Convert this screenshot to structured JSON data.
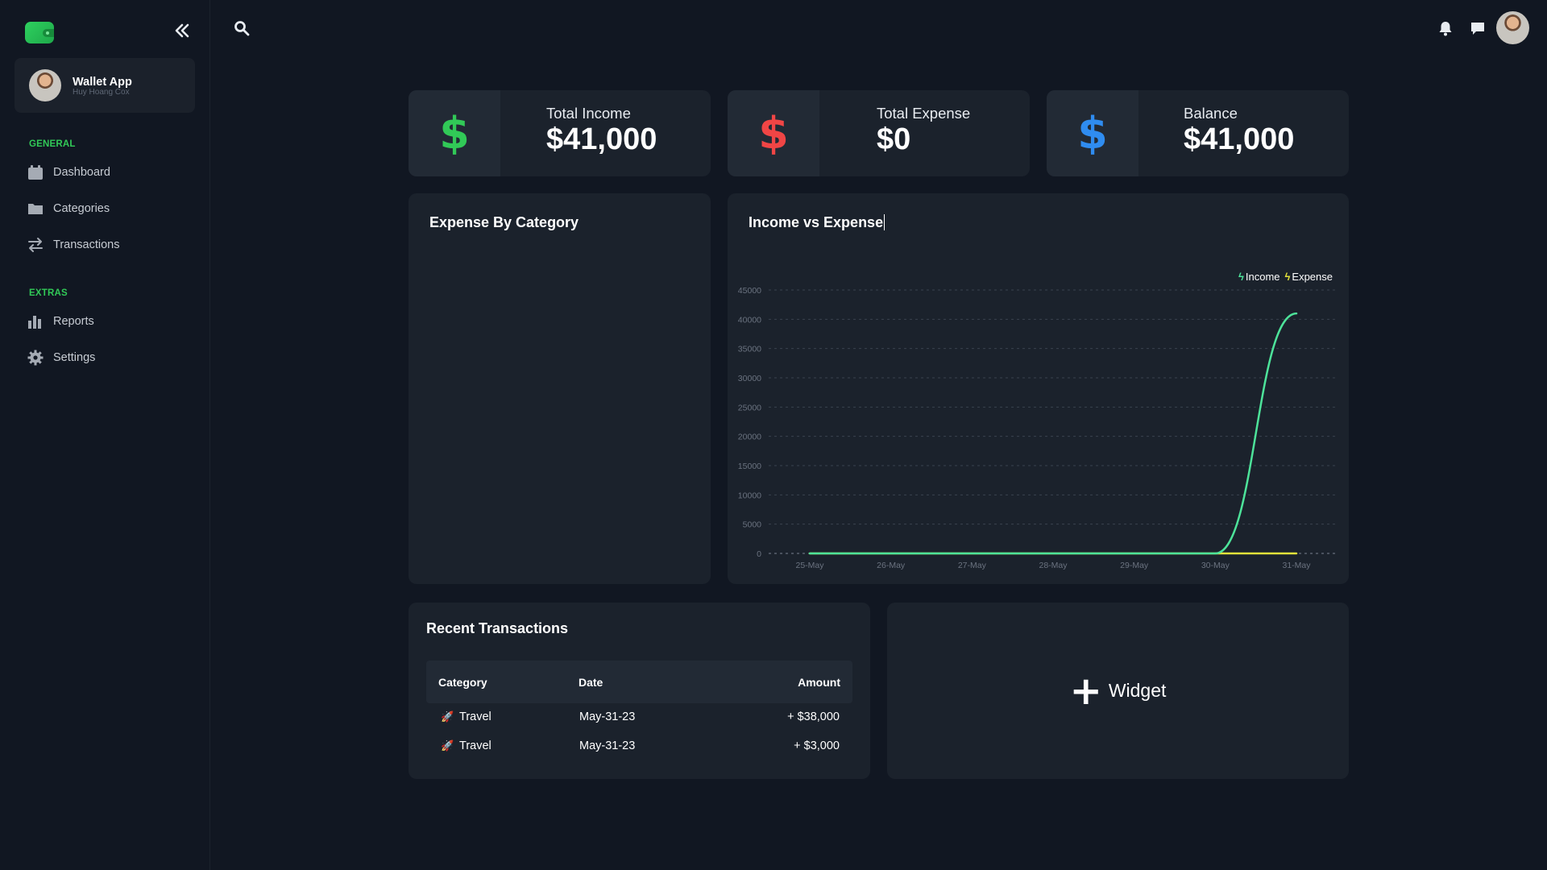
{
  "sidebar": {
    "profile": {
      "name": "Wallet App",
      "subtitle": "Huy Hoang Cox"
    },
    "sections": [
      {
        "title": "GENERAL",
        "items": [
          {
            "label": "Dashboard",
            "icon": "calendar-icon"
          },
          {
            "label": "Categories",
            "icon": "folder-icon"
          },
          {
            "label": "Transactions",
            "icon": "transfer-arrows-icon"
          }
        ]
      },
      {
        "title": "EXTRAS",
        "items": [
          {
            "label": "Reports",
            "icon": "bar-chart-icon"
          },
          {
            "label": "Settings",
            "icon": "gear-icon"
          }
        ]
      }
    ]
  },
  "stats": [
    {
      "label": "Total Income",
      "value": "$41,000",
      "symbol": "$",
      "color": "#31c957"
    },
    {
      "label": "Total Expense",
      "value": "$0",
      "symbol": "$",
      "color": "#f04545"
    },
    {
      "label": "Balance",
      "value": "$41,000",
      "symbol": "$",
      "color": "#2f8cf0"
    }
  ],
  "panels": {
    "expense_by_category": "Expense By Category",
    "income_vs_expense": "Income vs Expense",
    "recent_transactions": "Recent Transactions",
    "widget": "Widget"
  },
  "chart_data": {
    "type": "line",
    "title": "Income vs Expense",
    "categories": [
      "25-May",
      "26-May",
      "27-May",
      "28-May",
      "29-May",
      "30-May",
      "31-May"
    ],
    "yticks": [
      0,
      5000,
      10000,
      15000,
      20000,
      25000,
      30000,
      35000,
      40000,
      45000
    ],
    "ylim": [
      0,
      45000
    ],
    "series": [
      {
        "name": "Income",
        "color": "#4de39a",
        "values": [
          0,
          0,
          0,
          0,
          0,
          0,
          41000
        ]
      },
      {
        "name": "Expense",
        "color": "#e2e23a",
        "values": [
          0,
          0,
          0,
          0,
          0,
          0,
          0
        ]
      }
    ],
    "legend": "top-right",
    "grid": true
  },
  "table": {
    "headers": [
      "Category",
      "Date",
      "Amount"
    ],
    "rows": [
      {
        "category": "Travel",
        "date": "May-31-23",
        "amount": "+ $38,000"
      },
      {
        "category": "Travel",
        "date": "May-31-23",
        "amount": "+ $3,000"
      }
    ]
  }
}
